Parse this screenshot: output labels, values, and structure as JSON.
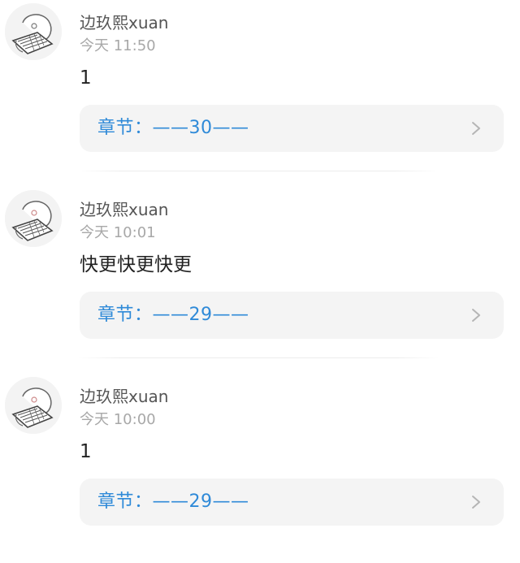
{
  "comments": [
    {
      "username": "边玖熙xuan",
      "time": "今天 11:50",
      "content": "1",
      "chapter_label": "章节：——30——"
    },
    {
      "username": "边玖熙xuan",
      "time": "今天 10:01",
      "content": "快更快更快更",
      "chapter_label": "章节：——29——"
    },
    {
      "username": "边玖熙xuan",
      "time": "今天 10:00",
      "content": "1",
      "chapter_label": "章节：——29——"
    }
  ],
  "icons": {
    "avatar": "avatar-keyboard-doodle-icon",
    "chevron": "chevron-right-icon"
  },
  "colors": {
    "chapter_text": "#2f8ad8",
    "card_bg": "#f4f4f4",
    "username": "#555555",
    "timestamp": "#a8a8a8"
  }
}
